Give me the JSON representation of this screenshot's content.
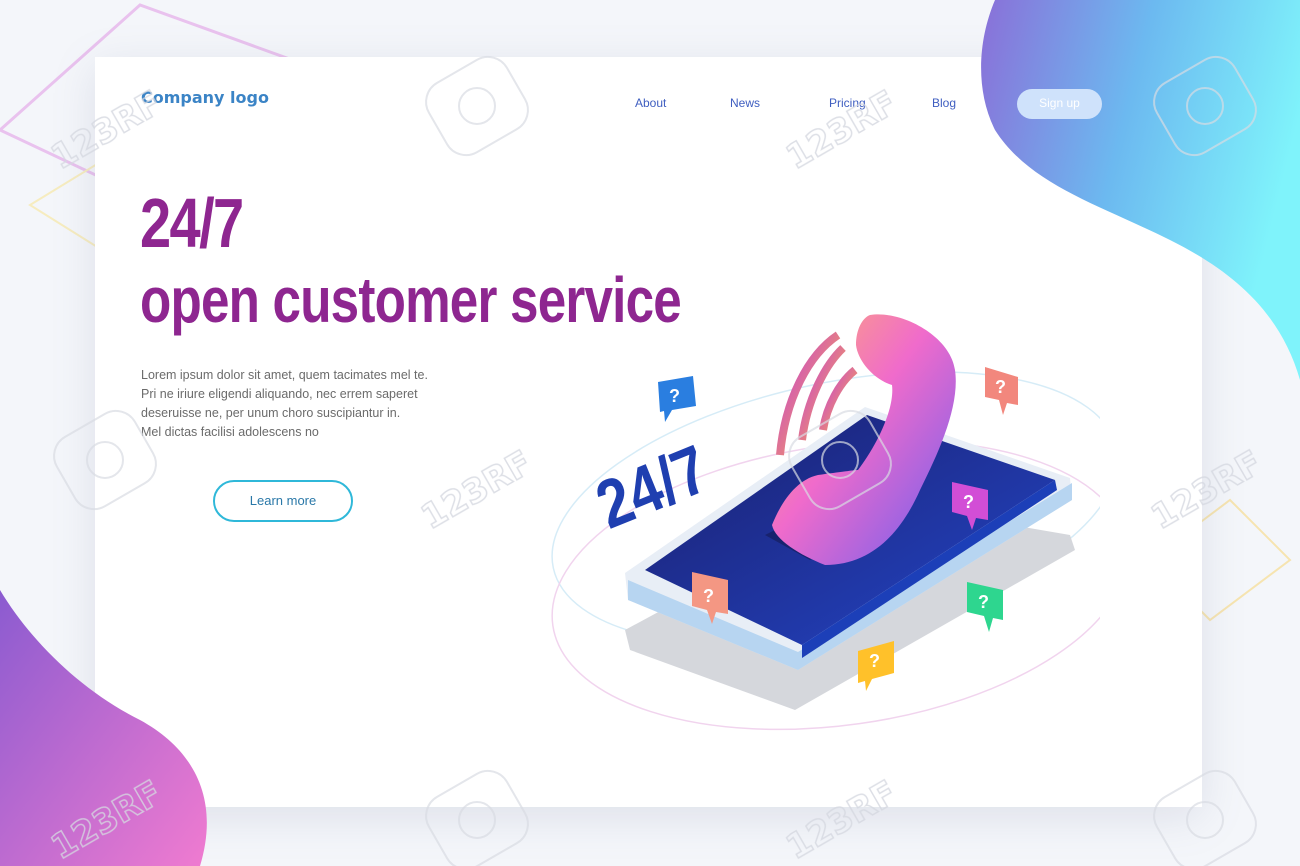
{
  "header": {
    "logo": "Company logo",
    "nav": [
      "About",
      "News",
      "Pricing",
      "Blog"
    ],
    "signup": "Sign up"
  },
  "hero": {
    "title_line1": "24/7",
    "title_line2": "open customer service",
    "body_lines": [
      "Lorem ipsum dolor sit amet, quem tacimates mel te.",
      "Pri ne iriure eligendi aliquando, nec errem saperet",
      "deseruisse ne, per unum choro suscipiantur in.",
      "Mel dictas facilisi adolescens no"
    ],
    "cta": "Learn more"
  },
  "illustration": {
    "phone_label": "24/7",
    "bubble_mark": "?"
  },
  "watermark": "123RF",
  "colors": {
    "headline": "#8e2690",
    "nav": "#3f5ec0",
    "logo": "#3b84c6",
    "cta_border": "#2fb8d9",
    "phone_screen": "#1b2a8c",
    "blob_top_right_start": "#8a6fd8",
    "blob_top_right_end": "#7ff3fb",
    "blob_bottom_left_start": "#8b5bd0",
    "blob_bottom_left_end": "#f07bd0"
  }
}
